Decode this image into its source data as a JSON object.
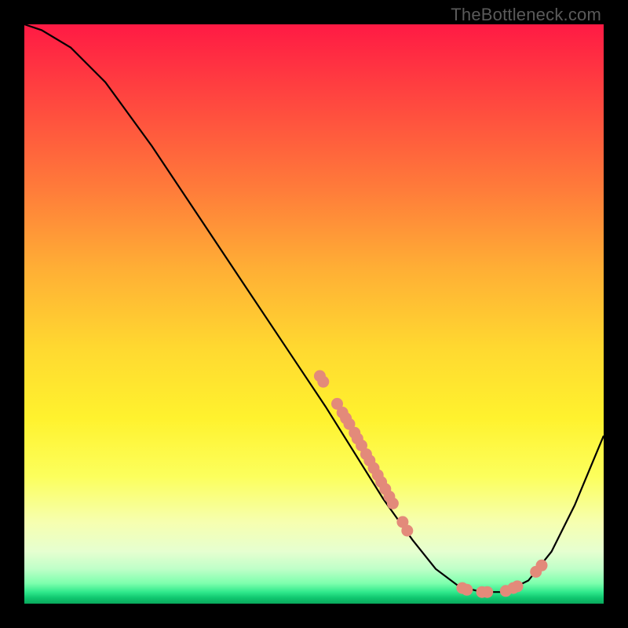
{
  "watermark": "TheBottleneck.com",
  "colors": {
    "dot": "#e38a7a",
    "curve": "#000000"
  },
  "chart_data": {
    "type": "line",
    "title": "",
    "xlabel": "",
    "ylabel": "",
    "xlim": [
      0,
      100
    ],
    "ylim": [
      0,
      100
    ],
    "curve": [
      {
        "x": 0,
        "y": 100
      },
      {
        "x": 3,
        "y": 99
      },
      {
        "x": 8,
        "y": 96
      },
      {
        "x": 14,
        "y": 90
      },
      {
        "x": 22,
        "y": 79
      },
      {
        "x": 30,
        "y": 67
      },
      {
        "x": 38,
        "y": 55
      },
      {
        "x": 46,
        "y": 43
      },
      {
        "x": 52,
        "y": 34
      },
      {
        "x": 57,
        "y": 26
      },
      {
        "x": 62,
        "y": 18
      },
      {
        "x": 67,
        "y": 11
      },
      {
        "x": 71,
        "y": 6
      },
      {
        "x": 75,
        "y": 3
      },
      {
        "x": 79,
        "y": 2
      },
      {
        "x": 83,
        "y": 2
      },
      {
        "x": 87,
        "y": 4
      },
      {
        "x": 91,
        "y": 9
      },
      {
        "x": 95,
        "y": 17
      },
      {
        "x": 100,
        "y": 29
      }
    ],
    "scatter": [
      {
        "x": 51.0,
        "y": 39.3
      },
      {
        "x": 51.6,
        "y": 38.3
      },
      {
        "x": 54.0,
        "y": 34.5
      },
      {
        "x": 54.9,
        "y": 33.0
      },
      {
        "x": 55.5,
        "y": 32.0
      },
      {
        "x": 56.1,
        "y": 31.0
      },
      {
        "x": 57.0,
        "y": 29.5
      },
      {
        "x": 57.5,
        "y": 28.5
      },
      {
        "x": 58.2,
        "y": 27.3
      },
      {
        "x": 59.0,
        "y": 25.8
      },
      {
        "x": 59.6,
        "y": 24.7
      },
      {
        "x": 60.3,
        "y": 23.4
      },
      {
        "x": 61.0,
        "y": 22.2
      },
      {
        "x": 61.6,
        "y": 21.0
      },
      {
        "x": 62.3,
        "y": 19.8
      },
      {
        "x": 63.0,
        "y": 18.5
      },
      {
        "x": 63.6,
        "y": 17.3
      },
      {
        "x": 65.3,
        "y": 14.1
      },
      {
        "x": 66.1,
        "y": 12.6
      },
      {
        "x": 75.6,
        "y": 2.7
      },
      {
        "x": 76.4,
        "y": 2.4
      },
      {
        "x": 79.0,
        "y": 2.0
      },
      {
        "x": 79.9,
        "y": 2.0
      },
      {
        "x": 83.1,
        "y": 2.2
      },
      {
        "x": 84.4,
        "y": 2.7
      },
      {
        "x": 85.1,
        "y": 3.0
      },
      {
        "x": 88.3,
        "y": 5.5
      },
      {
        "x": 89.3,
        "y": 6.6
      }
    ]
  }
}
